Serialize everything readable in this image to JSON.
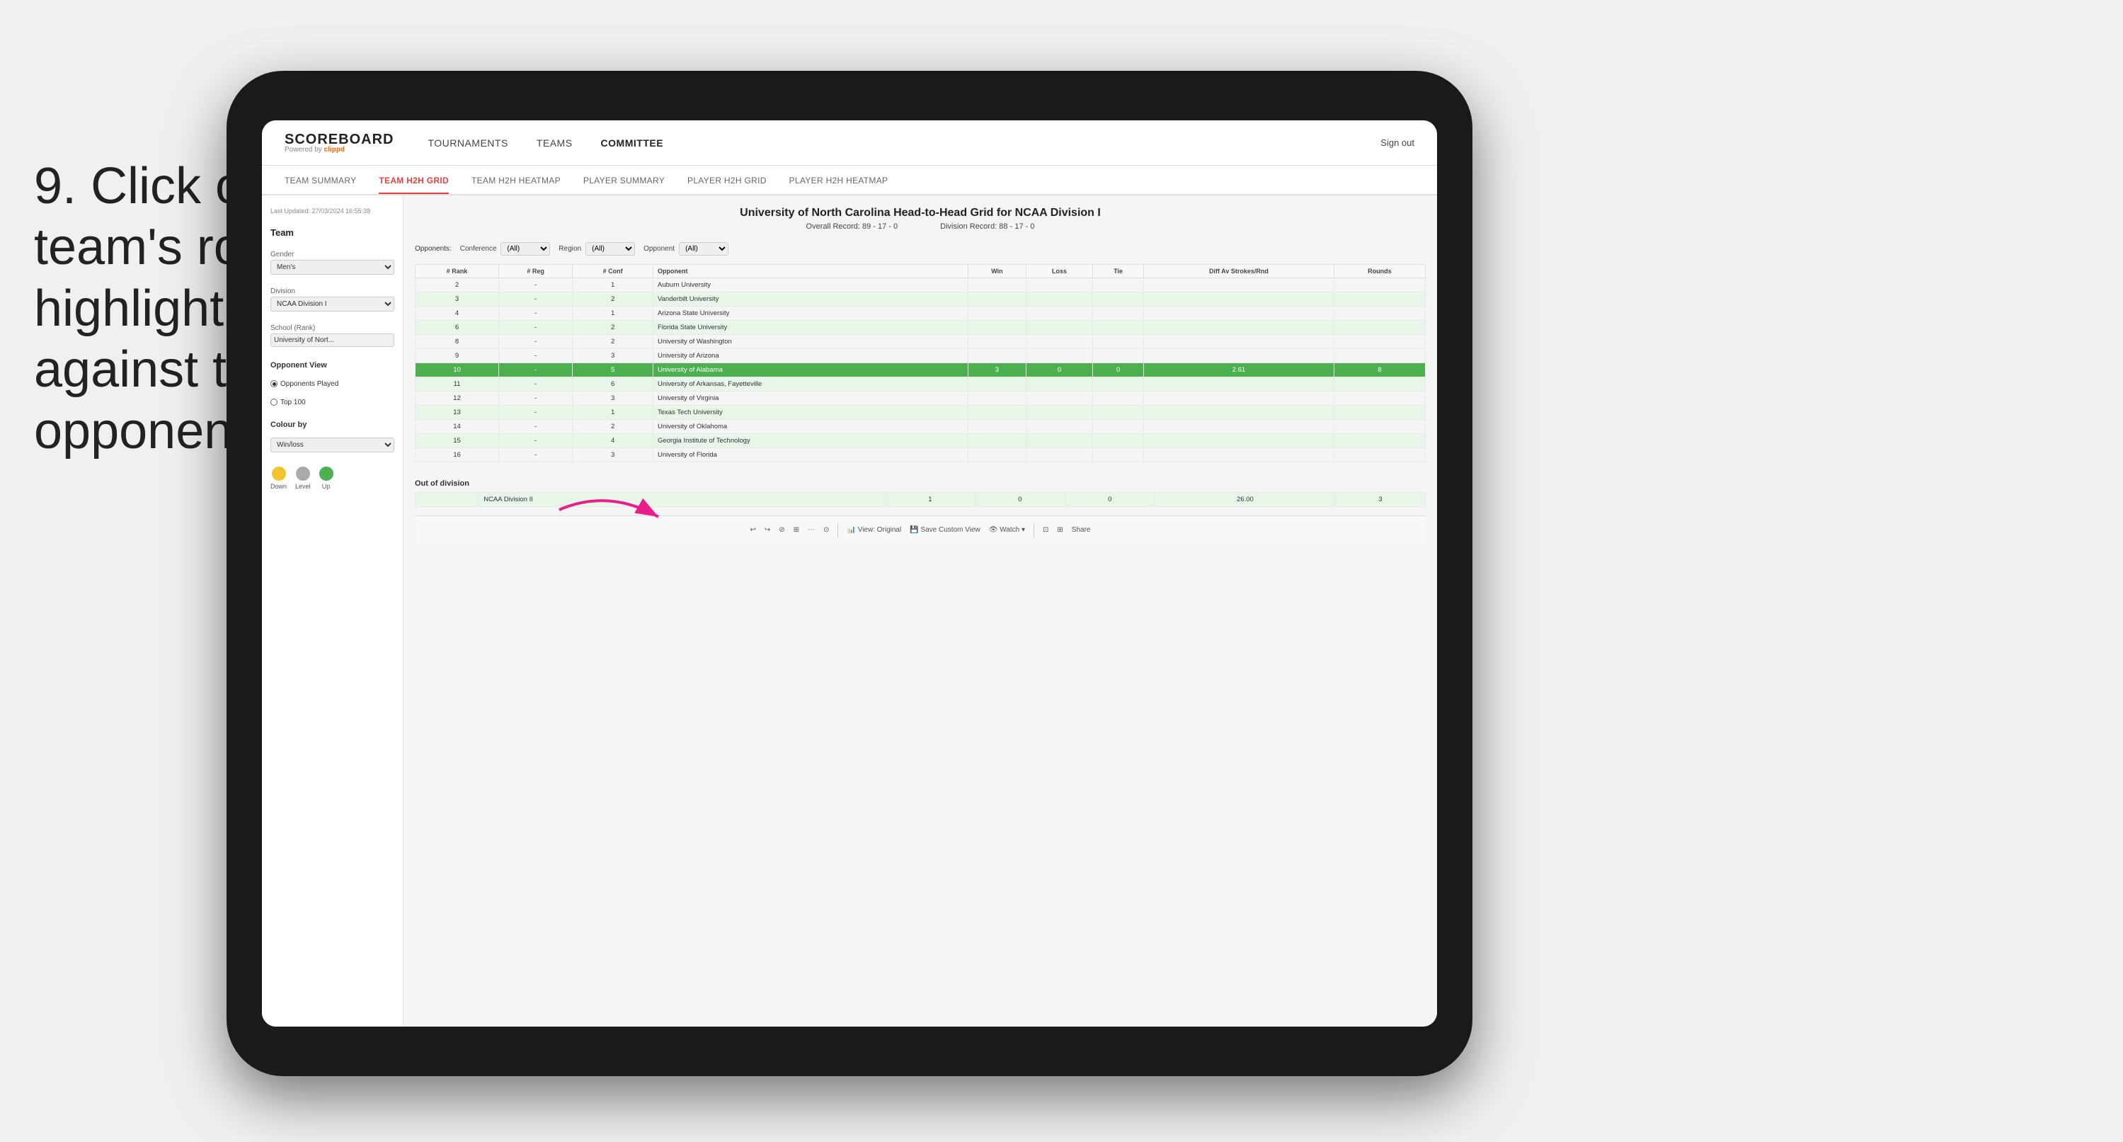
{
  "instruction": {
    "step": "9.",
    "text": "Click on a team's row to highlight results against that opponent"
  },
  "nav": {
    "logo": "SCOREBOARD",
    "powered_by": "Powered by",
    "brand": "clippd",
    "links": [
      "TOURNAMENTS",
      "TEAMS",
      "COMMITTEE"
    ],
    "sign_out": "Sign out"
  },
  "sub_nav": {
    "items": [
      "TEAM SUMMARY",
      "TEAM H2H GRID",
      "TEAM H2H HEATMAP",
      "PLAYER SUMMARY",
      "PLAYER H2H GRID",
      "PLAYER H2H HEATMAP"
    ],
    "active": "TEAM H2H GRID"
  },
  "sidebar": {
    "timestamp": "Last Updated: 27/03/2024\n16:55:38",
    "team_label": "Team",
    "gender_label": "Gender",
    "gender_value": "Men's",
    "division_label": "Division",
    "division_value": "NCAA Division I",
    "school_label": "School (Rank)",
    "school_value": "University of Nort...",
    "opponent_view_title": "Opponent View",
    "radio_options": [
      "Opponents Played",
      "Top 100"
    ],
    "radio_selected": "Opponents Played",
    "colour_by": "Colour by",
    "colour_by_value": "Win/loss",
    "legend": [
      {
        "label": "Down",
        "color": "#f4c430"
      },
      {
        "label": "Level",
        "color": "#aaa"
      },
      {
        "label": "Up",
        "color": "#4caf50"
      }
    ]
  },
  "grid": {
    "title": "University of North Carolina Head-to-Head Grid for NCAA Division I",
    "overall_record": "Overall Record: 89 - 17 - 0",
    "division_record": "Division Record: 88 - 17 - 0",
    "filters": {
      "opponents_label": "Opponents:",
      "conference_label": "Conference",
      "conference_value": "(All)",
      "region_label": "Region",
      "region_value": "(All)",
      "opponent_label": "Opponent",
      "opponent_value": "(All)"
    },
    "columns": [
      "# Rank",
      "# Reg",
      "# Conf",
      "Opponent",
      "Win",
      "Loss",
      "Tie",
      "Diff Av Strokes/Rnd",
      "Rounds"
    ],
    "rows": [
      {
        "rank": "2",
        "reg": "-",
        "conf": "1",
        "opponent": "Auburn University",
        "win": "",
        "loss": "",
        "tie": "",
        "diff": "",
        "rounds": "",
        "style": "normal"
      },
      {
        "rank": "3",
        "reg": "-",
        "conf": "2",
        "opponent": "Vanderbilt University",
        "win": "",
        "loss": "",
        "tie": "",
        "diff": "",
        "rounds": "",
        "style": "light"
      },
      {
        "rank": "4",
        "reg": "-",
        "conf": "1",
        "opponent": "Arizona State University",
        "win": "",
        "loss": "",
        "tie": "",
        "diff": "",
        "rounds": "",
        "style": "normal"
      },
      {
        "rank": "6",
        "reg": "-",
        "conf": "2",
        "opponent": "Florida State University",
        "win": "",
        "loss": "",
        "tie": "",
        "diff": "",
        "rounds": "",
        "style": "light"
      },
      {
        "rank": "8",
        "reg": "-",
        "conf": "2",
        "opponent": "University of Washington",
        "win": "",
        "loss": "",
        "tie": "",
        "diff": "",
        "rounds": "",
        "style": "normal"
      },
      {
        "rank": "9",
        "reg": "-",
        "conf": "3",
        "opponent": "University of Arizona",
        "win": "",
        "loss": "",
        "tie": "",
        "diff": "",
        "rounds": "",
        "style": "normal"
      },
      {
        "rank": "10",
        "reg": "-",
        "conf": "5",
        "opponent": "University of Alabama",
        "win": "3",
        "loss": "0",
        "tie": "0",
        "diff": "2.61",
        "rounds": "8",
        "style": "highlighted"
      },
      {
        "rank": "11",
        "reg": "-",
        "conf": "6",
        "opponent": "University of Arkansas, Fayetteville",
        "win": "",
        "loss": "",
        "tie": "",
        "diff": "",
        "rounds": "",
        "style": "light"
      },
      {
        "rank": "12",
        "reg": "-",
        "conf": "3",
        "opponent": "University of Virginia",
        "win": "",
        "loss": "",
        "tie": "",
        "diff": "",
        "rounds": "",
        "style": "normal"
      },
      {
        "rank": "13",
        "reg": "-",
        "conf": "1",
        "opponent": "Texas Tech University",
        "win": "",
        "loss": "",
        "tie": "",
        "diff": "",
        "rounds": "",
        "style": "light"
      },
      {
        "rank": "14",
        "reg": "-",
        "conf": "2",
        "opponent": "University of Oklahoma",
        "win": "",
        "loss": "",
        "tie": "",
        "diff": "",
        "rounds": "",
        "style": "normal"
      },
      {
        "rank": "15",
        "reg": "-",
        "conf": "4",
        "opponent": "Georgia Institute of Technology",
        "win": "",
        "loss": "",
        "tie": "",
        "diff": "",
        "rounds": "",
        "style": "light"
      },
      {
        "rank": "16",
        "reg": "-",
        "conf": "3",
        "opponent": "University of Florida",
        "win": "",
        "loss": "",
        "tie": "",
        "diff": "",
        "rounds": "",
        "style": "normal"
      }
    ],
    "out_of_division": {
      "title": "Out of division",
      "rows": [
        {
          "label": "NCAA Division II",
          "win": "1",
          "loss": "0",
          "tie": "0",
          "diff": "26.00",
          "rounds": "3"
        }
      ]
    }
  },
  "toolbar": {
    "buttons": [
      "↩",
      "↪",
      "↩↪",
      "⊞",
      "⋯",
      "⊙",
      "View: Original",
      "Save Custom View",
      "Watch ▾",
      "⊡",
      "⊞",
      "Share"
    ]
  }
}
